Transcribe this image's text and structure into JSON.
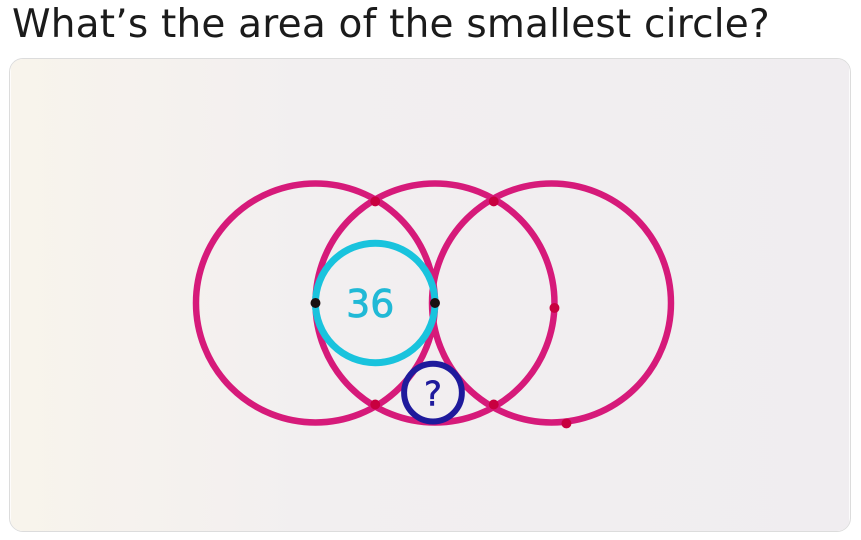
{
  "post": {
    "question": "What’s the area of the smallest circle?"
  },
  "diagram": {
    "medium_circle_label": "36",
    "smallest_circle_label": "?",
    "colors": {
      "large_circles": "#d61a7a",
      "medium_circle": "#19c3dd",
      "medium_circle_number": "#21b9d6",
      "small_circle": "#1f1a9c",
      "background": "#f1eef0"
    }
  }
}
